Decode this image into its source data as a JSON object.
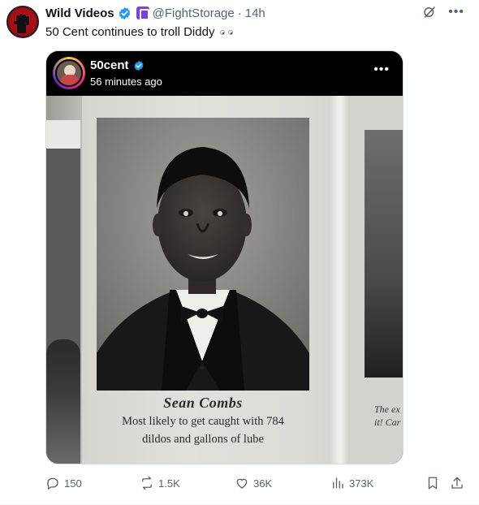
{
  "tweet": {
    "display_name": "Wild Videos",
    "handle": "@FightStorage",
    "separator": "·",
    "time": "14h",
    "text": "50 Cent continues to troll Diddy"
  },
  "embed": {
    "account": "50cent",
    "posted": "56 minutes ago",
    "caption_name": "Sean Combs",
    "caption_line1": "Most likely to get caught with 784",
    "caption_line2": "dildos and gallons of lube",
    "right_caption_line1": "The ex",
    "right_caption_line2": "it! Car"
  },
  "actions": {
    "replies": "150",
    "reposts": "1.5K",
    "likes": "36K",
    "views": "373K"
  },
  "colors": {
    "verified": "#1d9bf0",
    "affiliate": "#7b3fe4",
    "muted_text": "#536471",
    "avatar_red": "#c0151d"
  },
  "icons": [
    "fist-icon",
    "verified-badge-icon",
    "affiliate-badge-icon",
    "grok-icon",
    "more-icon",
    "reply-icon",
    "repost-icon",
    "like-icon",
    "views-icon",
    "bookmark-icon",
    "share-icon"
  ]
}
